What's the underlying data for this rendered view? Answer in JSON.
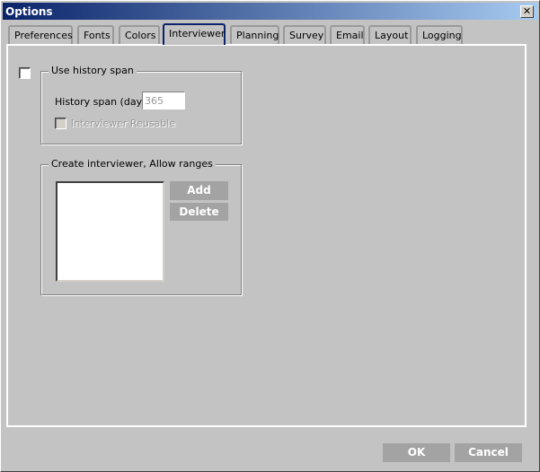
{
  "window": {
    "title": "Options",
    "close_icon": "close-icon"
  },
  "tabs": [
    {
      "label": "Preferences"
    },
    {
      "label": "Fonts"
    },
    {
      "label": "Colors"
    },
    {
      "label": "Interviewer",
      "selected": true
    },
    {
      "label": "Planning"
    },
    {
      "label": "Survey"
    },
    {
      "label": "Email"
    },
    {
      "label": "Layout"
    },
    {
      "label": "Logging"
    }
  ],
  "history": {
    "checkbox_checked": false,
    "group_label": "Use history span",
    "span_label": "History span (days):",
    "span_value": "365",
    "reusable_label": "Interviewer Reusable",
    "reusable_checked": false
  },
  "ranges": {
    "group_label": "Create interviewer, Allow ranges",
    "add_label": "Add",
    "delete_label": "Delete"
  },
  "footer": {
    "ok_label": "OK",
    "cancel_label": "Cancel"
  }
}
